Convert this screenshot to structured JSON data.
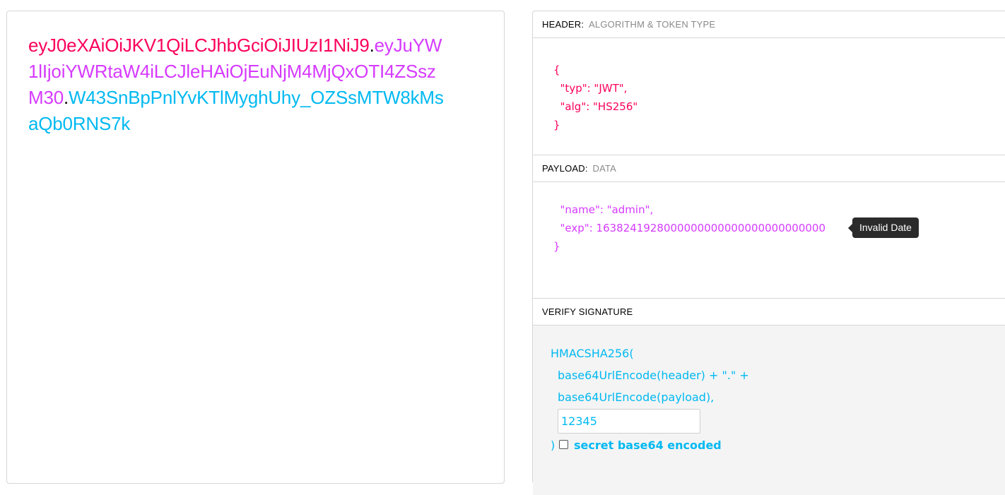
{
  "encoded": {
    "header": "eyJ0eXAiOiJKV1QiLCJhbGciOiJIUzI1NiJ9",
    "payload": "eyJuYW1lIjoiYWRtaW4iLCJleHAiOjEuNjM4MjQxOTI4ZSszM30",
    "signature": "W43SnBpPnlYvKTlMyghUhy_OZSsMTW8kMsaQb0RNS7k",
    "dot": "."
  },
  "decoded": {
    "header_section": {
      "title": "HEADER:",
      "subtitle": "ALGORITHM & TOKEN TYPE",
      "json": "{\n  \"typ\": \"JWT\",\n  \"alg\": \"HS256\"\n}"
    },
    "payload_section": {
      "title": "PAYLOAD:",
      "subtitle": "DATA",
      "json_line1": "  \"name\": \"admin\",",
      "json_line2": "  \"exp\": 1638241928000000000000000000000000",
      "json_line3": "}",
      "tooltip": "Invalid Date"
    },
    "verify_section": {
      "title": "VERIFY SIGNATURE",
      "line1": "HMACSHA256(",
      "line2": "base64UrlEncode(header) + \".\" +",
      "line3": "base64UrlEncode(payload),",
      "secret_value": "12345",
      "closing": ")",
      "checkbox_label": "secret base64 encoded",
      "checkbox_checked": false
    }
  },
  "colors": {
    "header": "#fb015b",
    "payload": "#d63aff",
    "signature": "#00b9f1"
  }
}
